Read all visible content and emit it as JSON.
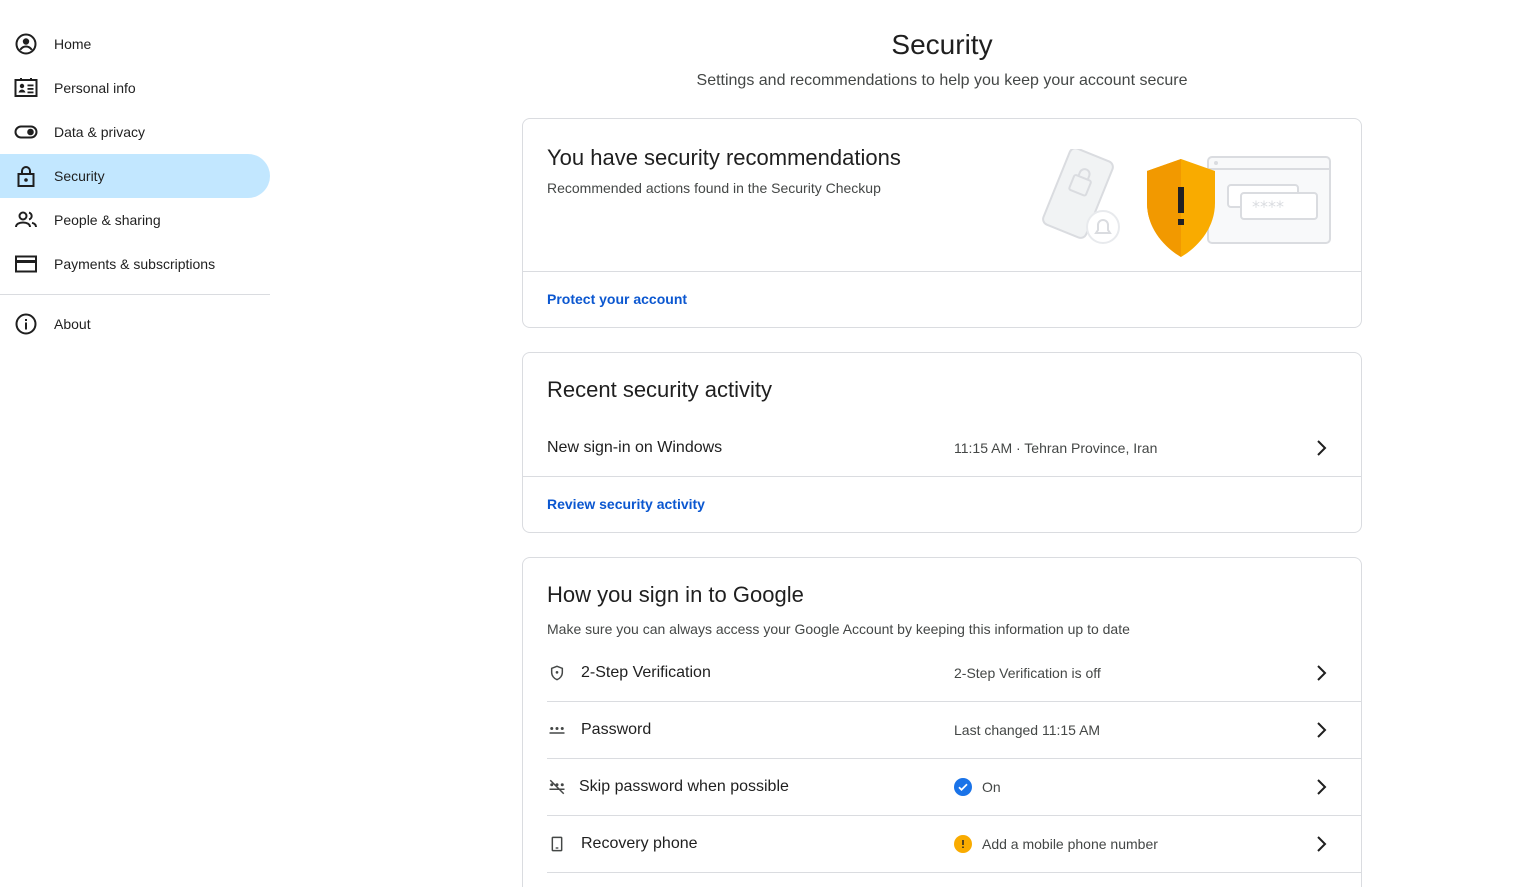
{
  "sidebar": {
    "items": [
      {
        "label": "Home",
        "icon": "account-circle-icon"
      },
      {
        "label": "Personal info",
        "icon": "id-card-icon"
      },
      {
        "label": "Data & privacy",
        "icon": "toggle-icon"
      },
      {
        "label": "Security",
        "icon": "lock-icon",
        "active": true
      },
      {
        "label": "People & sharing",
        "icon": "people-icon"
      },
      {
        "label": "Payments & subscriptions",
        "icon": "credit-card-icon"
      },
      {
        "label": "About",
        "icon": "info-icon"
      }
    ]
  },
  "header": {
    "title": "Security",
    "subtitle": "Settings and recommendations to help you keep your account secure"
  },
  "recommendations": {
    "title": "You have security recommendations",
    "description": "Recommended actions found in the Security Checkup",
    "link": "Protect your account"
  },
  "activity": {
    "title": "Recent security activity",
    "event_label": "New sign-in on Windows",
    "event_detail": "11:15 AM · Tehran Province, Iran",
    "link": "Review security activity"
  },
  "signin": {
    "title": "How you sign in to Google",
    "description": "Make sure you can always access your Google Account by keeping this information up to date",
    "rows": [
      {
        "label": "2-Step Verification",
        "value": "2-Step Verification is off",
        "icon": "shield-icon"
      },
      {
        "label": "Password",
        "value": "Last changed 11:15 AM",
        "icon": "password-dots-icon"
      },
      {
        "label": "Skip password when possible",
        "value": "On",
        "icon": "passkey-icon",
        "status": "check"
      },
      {
        "label": "Recovery phone",
        "value": "Add a mobile phone number",
        "icon": "phone-icon",
        "status": "warning"
      }
    ]
  },
  "colors": {
    "active_nav_bg": "#c2e7ff",
    "link": "#0b57d0",
    "check": "#1a73e8",
    "warning": "#f9ab00",
    "shield": "#f9ab00"
  }
}
